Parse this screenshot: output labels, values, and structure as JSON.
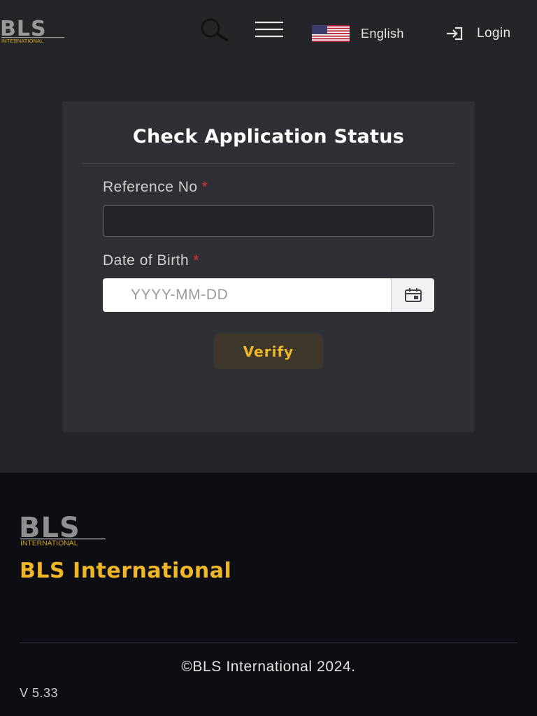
{
  "header": {
    "logo_text": "BLS",
    "logo_sub": "INTERNATIONAL",
    "search_icon": "search-icon",
    "menu_icon": "hamburger-menu-icon",
    "language": {
      "flag": "us-flag-icon",
      "label": "English"
    },
    "login": {
      "icon": "login-icon",
      "label": "Login"
    }
  },
  "form": {
    "title": "Check Application Status",
    "reference": {
      "label": "Reference No",
      "required_mark": "*",
      "value": "",
      "placeholder": ""
    },
    "dob": {
      "label": "Date of Birth",
      "required_mark": "*",
      "value": "",
      "placeholder": "YYYY-MM-DD",
      "icon": "calendar-icon"
    },
    "verify_label": "Verify"
  },
  "footer": {
    "logo_text": "BLS",
    "logo_sub": "INTERNATIONAL",
    "brand": "BLS International",
    "copyright": "©BLS International 2024.",
    "version": "V 5.33"
  },
  "colors": {
    "accent": "#f0b62a",
    "required": "#e0342e",
    "background": "#232529",
    "card": "#2e3035",
    "footer": "#0d0d14"
  }
}
